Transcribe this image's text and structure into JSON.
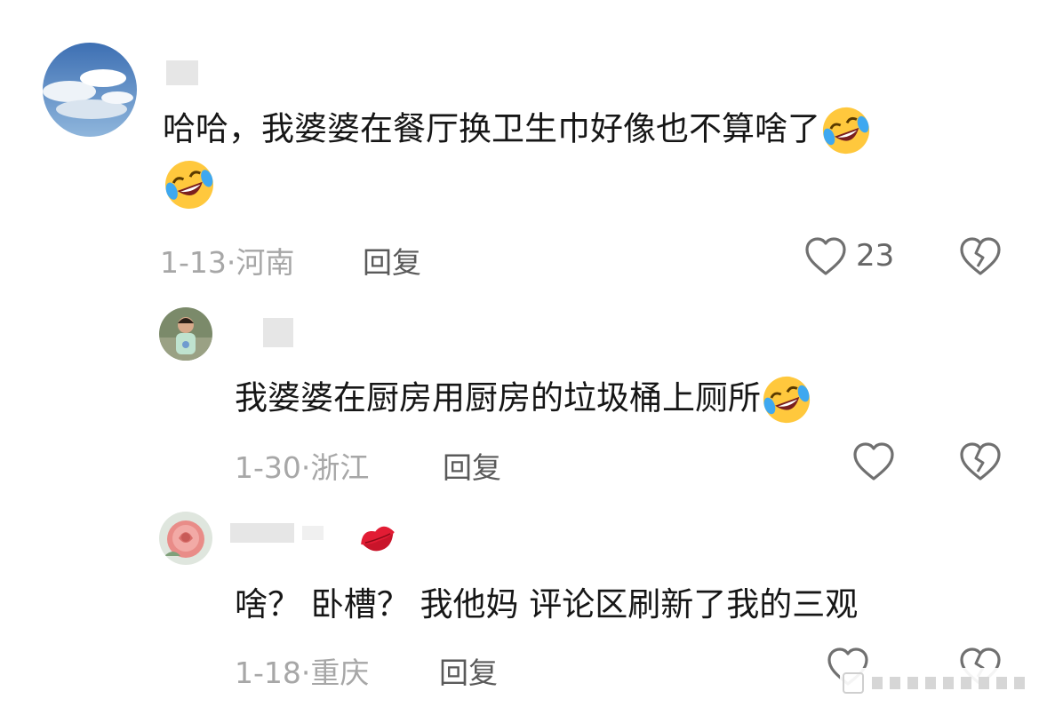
{
  "comments": [
    {
      "text": "哈哈，我婆婆在餐厅换卫生巾好像也不算啥了",
      "date": "1-13",
      "location": "河南",
      "reply_label": "回复",
      "likes": "23",
      "avatar": "sky-clouds-avatar",
      "emojis": [
        "rolling-laughing-emoji",
        "rolling-laughing-emoji"
      ]
    },
    {
      "text": "我婆婆在厨房用厨房的垃圾桶上厕所",
      "date": "1-30",
      "location": "浙江",
      "reply_label": "回复",
      "likes": "",
      "avatar": "child-photo-avatar",
      "emojis": [
        "rolling-laughing-emoji"
      ]
    },
    {
      "text": "啥？ 卧槽？ 我他妈 评论区刷新了我的三观",
      "date": "1-18",
      "location": "重庆",
      "reply_label": "回复",
      "likes": "",
      "avatar": "rose-flower-avatar",
      "badge": "lips-kiss-icon"
    }
  ],
  "separator": "·",
  "colors": {
    "meta": "#a7a7a7",
    "icon": "#707070",
    "emoji_face": "#ffc83d",
    "emoji_tears": "#3ea8f0",
    "lips": "#e21c34"
  }
}
